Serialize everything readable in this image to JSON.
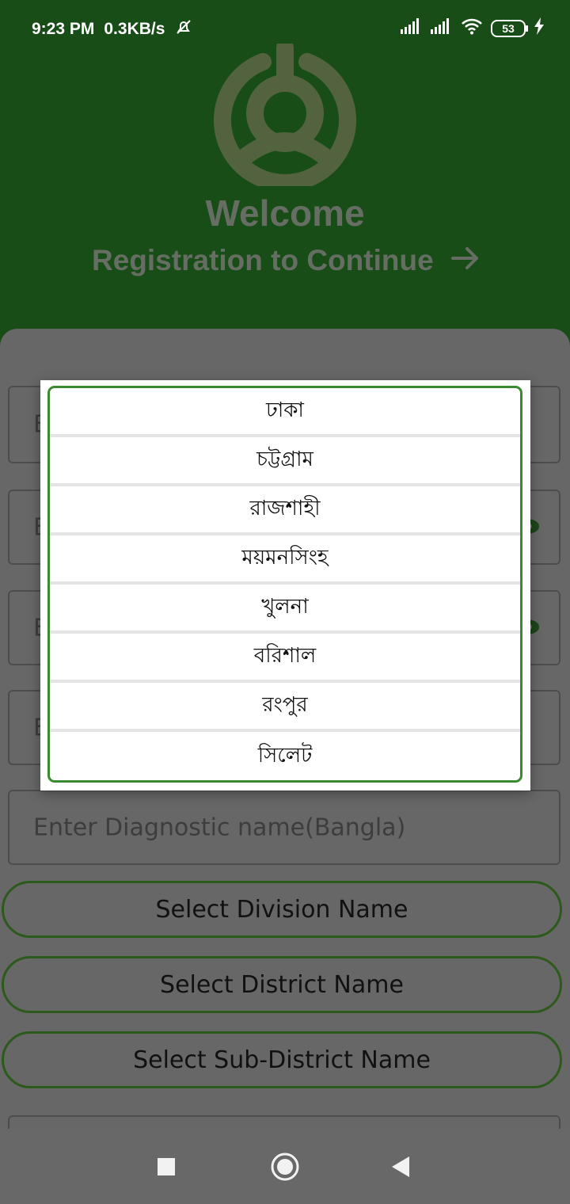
{
  "status_bar": {
    "time": "9:23 PM",
    "network_speed": "0.3KB/s",
    "battery_level": "53",
    "icons": [
      "mute-icon",
      "signal-icon",
      "signal-icon",
      "wifi-icon",
      "battery-icon",
      "charging-icon"
    ]
  },
  "header": {
    "welcome": "Welcome",
    "subtitle": "Registration to Continue",
    "arrow_icon": "arrow-right-icon",
    "logo_icon": "person-logo-icon"
  },
  "form": {
    "field_1_placeholder": "E",
    "field_2_placeholder": "E",
    "field_3_placeholder": "E",
    "field_4_placeholder": "E",
    "diagnostic_bangla_placeholder": "Enter Diagnostic name(Bangla)",
    "division_button": "Select Division Name",
    "district_button": "Select District Name",
    "subdistrict_button": "Select Sub-District Name"
  },
  "dialog": {
    "items": [
      "ঢাকা",
      "চট্টগ্রাম",
      "রাজশাহী",
      "ময়মনসিংহ",
      "খুলনা",
      "বরিশাল",
      "রংপুর",
      "সিলেট"
    ]
  },
  "navbar": {
    "icons": [
      "recents-icon",
      "home-icon",
      "back-icon"
    ]
  },
  "colors": {
    "header_green": "#184d18",
    "accent_green": "#3a8a32",
    "overlay_gray": "#676767"
  }
}
